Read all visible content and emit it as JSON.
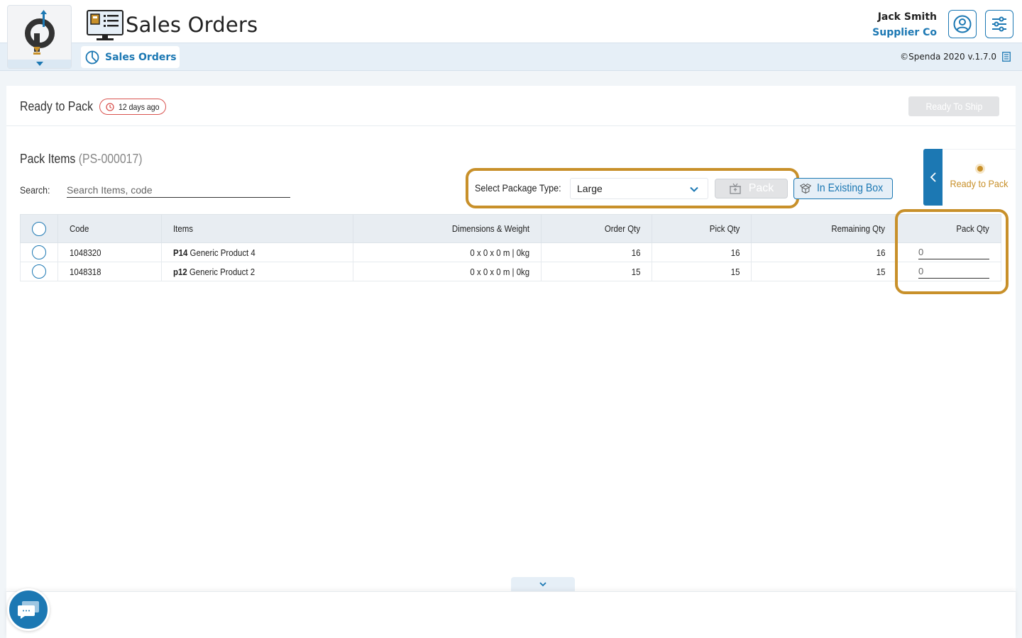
{
  "header": {
    "app_title": "Sales Orders",
    "user_name": "Jack Smith",
    "company": "Supplier Co",
    "icons": {
      "logo": "spenda-logo",
      "app": "sales-orders-monitor-icon",
      "profile": "user-circle-icon",
      "settings": "sliders-icon"
    }
  },
  "subheader": {
    "tab_label": "Sales Orders",
    "version": "©Spenda 2020 v.1.7.0"
  },
  "status": {
    "title": "Ready to Pack",
    "ago": "12 days ago",
    "ship_button": "Ready To Ship"
  },
  "pack": {
    "title": "Pack Items",
    "pack_id": "(PS-000017)",
    "search_label": "Search:",
    "search_placeholder": "Search Items, code",
    "package_type_label": "Select Package Type:",
    "package_type_value": "Large",
    "pack_button": "Pack",
    "existing_box_button": "In Existing Box",
    "side_status": "Ready to Pack"
  },
  "table": {
    "columns": [
      "Code",
      "Items",
      "Dimensions & Weight",
      "Order Qty",
      "Pick Qty",
      "Remaining Qty",
      "Pack Qty"
    ],
    "rows": [
      {
        "code": "1048320",
        "item_code": "P14",
        "item_name": "Generic Product 4",
        "dimensions": "0 x 0 x 0 m | 0kg",
        "order_qty": "16",
        "pick_qty": "16",
        "remaining_qty": "16",
        "pack_qty": "0"
      },
      {
        "code": "1048318",
        "item_code": "p12",
        "item_name": "Generic Product 2",
        "dimensions": "0 x 0 x 0 m | 0kg",
        "order_qty": "15",
        "pick_qty": "15",
        "remaining_qty": "15",
        "pack_qty": "0"
      }
    ]
  },
  "colors": {
    "primary": "#1c78b3",
    "accent": "#c8902a",
    "danger": "#d9534f",
    "disabled": "#e2e3e5"
  }
}
